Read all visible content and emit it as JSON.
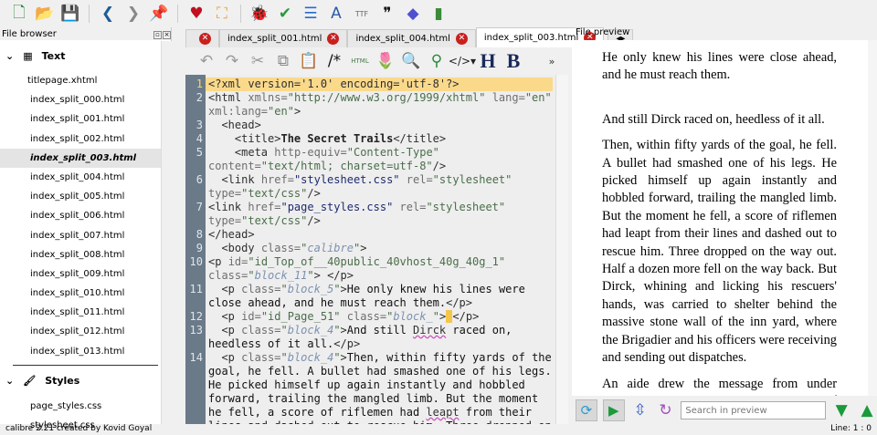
{
  "toolbar": {
    "icons": [
      "new-file-icon",
      "open-folder-icon",
      "save-icon",
      "back-icon",
      "forward-icon",
      "pin-icon",
      "heart-icon",
      "fullscreen-icon",
      "bug-icon",
      "spellcheck-icon",
      "reports-icon",
      "translate-icon",
      "font-icon",
      "quote-icon",
      "diamond-icon",
      "stats-icon"
    ],
    "glyphs": [
      "🗋",
      "📂",
      "💾",
      "❮",
      "❯",
      "📌",
      "♥",
      "⛶",
      "🐞",
      "✔",
      "☰",
      "A",
      "TTF",
      "❞",
      "◆",
      "▮"
    ]
  },
  "file_browser": {
    "title": "File browser",
    "groups": [
      {
        "label": "Text",
        "items": [
          "titlepage.xhtml",
          "index_split_000.html",
          "index_split_001.html",
          "index_split_002.html",
          "index_split_003.html",
          "index_split_004.html",
          "index_split_005.html",
          "index_split_006.html",
          "index_split_007.html",
          "index_split_008.html",
          "index_split_009.html",
          "index_split_010.html",
          "index_split_011.html",
          "index_split_012.html",
          "index_split_013.html"
        ],
        "selected": 4
      },
      {
        "label": "Styles",
        "items": [
          "page_styles.css",
          "stylesheet.css"
        ]
      }
    ]
  },
  "tabs": [
    {
      "label": "",
      "active": false
    },
    {
      "label": "index_split_001.html",
      "active": false
    },
    {
      "label": "index_split_004.html",
      "active": false
    },
    {
      "label": "index_split_003.html",
      "active": true
    }
  ],
  "editor_toolbar": {
    "glyphs": [
      "↶",
      "↷",
      "✂",
      "⧉",
      "📋",
      "/*",
      "HTML",
      "🌷",
      "🔍",
      "⚲",
      "</>▾",
      "H",
      "B",
      "»"
    ],
    "icons": [
      "undo-icon",
      "redo-icon",
      "cut-icon",
      "copy-icon",
      "paste-icon",
      "comment-icon",
      "html-icon",
      "tulip-icon",
      "image-search-icon",
      "link-icon",
      "tag-menu-icon",
      "heading-icon",
      "bold-icon",
      "more-icon"
    ]
  },
  "code": {
    "lines": [
      {
        "n": "1",
        "hl": true,
        "segs": [
          [
            "tag",
            "<?xml version='1.0' encoding='utf-8'?>"
          ]
        ]
      },
      {
        "n": "2",
        "segs": [
          [
            "tag",
            "<html "
          ],
          [
            "an",
            "xmlns="
          ],
          [
            "sv",
            "\"http://www.w3.org/1999/xhtml\" "
          ],
          [
            "an",
            "lang="
          ],
          [
            "sv",
            "\"en\" "
          ],
          [
            "an",
            "xml:lang="
          ],
          [
            "sv",
            "\"en\""
          ],
          [
            "tag",
            ">"
          ]
        ]
      },
      {
        "n": "3",
        "segs": [
          [
            "tag",
            "  <head>"
          ]
        ]
      },
      {
        "n": "4",
        "segs": [
          [
            "tag",
            "    <title>"
          ],
          [
            "bold",
            "The Secret Trails"
          ],
          [
            "tag",
            "</title>"
          ]
        ]
      },
      {
        "n": "5",
        "segs": [
          [
            "tag",
            "    <meta "
          ],
          [
            "an",
            "http-equiv="
          ],
          [
            "sv",
            "\"Content-Type\" "
          ],
          [
            "an",
            "content="
          ],
          [
            "sv",
            "\"text/html; charset=utf-8\""
          ],
          [
            "tag",
            "/>"
          ]
        ]
      },
      {
        "n": "6",
        "segs": [
          [
            "tag",
            "  <link "
          ],
          [
            "an",
            "href="
          ],
          [
            "sb",
            "\"stylesheet.css\" "
          ],
          [
            "an",
            "rel="
          ],
          [
            "sv",
            "\"stylesheet\" "
          ],
          [
            "an",
            "type="
          ],
          [
            "sv",
            "\"text/css\""
          ],
          [
            "tag",
            "/>"
          ]
        ]
      },
      {
        "n": "7",
        "segs": [
          [
            "tag",
            "<link "
          ],
          [
            "an",
            "href="
          ],
          [
            "sb",
            "\"page_styles.css\" "
          ],
          [
            "an",
            "rel="
          ],
          [
            "sv",
            "\"stylesheet\" "
          ],
          [
            "an",
            "type="
          ],
          [
            "sv",
            "\"text/css\""
          ],
          [
            "tag",
            "/>"
          ]
        ]
      },
      {
        "n": "8",
        "segs": [
          [
            "tag",
            "</head>"
          ]
        ]
      },
      {
        "n": "9",
        "segs": [
          [
            "tag",
            "  <body "
          ],
          [
            "an",
            "class="
          ],
          [
            "sv",
            "\""
          ],
          [
            "ci",
            "calibre"
          ],
          [
            "sv",
            "\""
          ],
          [
            "tag",
            ">"
          ]
        ]
      },
      {
        "n": "10",
        "segs": [
          [
            "tag",
            "<p "
          ],
          [
            "an",
            "id="
          ],
          [
            "sv",
            "\"id_Top_of__40public_40vhost_40g_40g_1\" "
          ],
          [
            "an",
            "class="
          ],
          [
            "sv",
            "\""
          ],
          [
            "ci",
            "block_11"
          ],
          [
            "sv",
            "\""
          ],
          [
            "tag",
            "> </p>"
          ]
        ]
      },
      {
        "n": "11",
        "segs": [
          [
            "tag",
            "  <p "
          ],
          [
            "an",
            "class="
          ],
          [
            "sv",
            "\""
          ],
          [
            "ci",
            "block_5"
          ],
          [
            "sv",
            "\""
          ],
          [
            "tag",
            ">"
          ],
          [
            "tx",
            "He only knew his lines were close ahead, and he must reach them."
          ],
          [
            "tag",
            "</p>"
          ]
        ]
      },
      {
        "n": "12",
        "segs": [
          [
            "tag",
            "  <p "
          ],
          [
            "an",
            "id="
          ],
          [
            "sv",
            "\"id_Page_51\" "
          ],
          [
            "an",
            "class="
          ],
          [
            "sv",
            "\""
          ],
          [
            "ci",
            "block_"
          ],
          [
            "sv",
            "\""
          ],
          [
            "tag",
            ">"
          ],
          [
            "cur",
            " "
          ],
          [
            "tag",
            "</p>"
          ]
        ]
      },
      {
        "n": "13",
        "segs": [
          [
            "tag",
            "  <p "
          ],
          [
            "an",
            "class="
          ],
          [
            "sv",
            "\""
          ],
          [
            "ci",
            "block_4"
          ],
          [
            "sv",
            "\""
          ],
          [
            "tag",
            ">"
          ],
          [
            "tx",
            "And still "
          ],
          [
            "sp",
            "Dirck"
          ],
          [
            "tx",
            " raced on, heedless of it all."
          ],
          [
            "tag",
            "</p>"
          ]
        ]
      },
      {
        "n": "14",
        "segs": [
          [
            "tag",
            "  <p "
          ],
          [
            "an",
            "class="
          ],
          [
            "sv",
            "\""
          ],
          [
            "ci",
            "block_4"
          ],
          [
            "sv",
            "\""
          ],
          [
            "tag",
            ">"
          ],
          [
            "tx",
            "Then, within fifty yards of the goal, he fell. A bullet had smashed one of his legs. He picked himself up again instantly and hobbled forward, trailing the mangled limb. But the moment he fell, a score of riflemen had "
          ],
          [
            "sp",
            "leapt"
          ],
          [
            "tx",
            " from their lines and dashed out to rescue him. Three dropped on the way"
          ]
        ]
      }
    ]
  },
  "preview": {
    "title": "File preview",
    "paragraphs": [
      "He only knew his lines were close ahead, and he must reach them.",
      "And still Dirck raced on, heedless of it all.",
      "Then, within fifty yards of the goal, he fell. A bullet had smashed one of his legs. He picked himself up again instantly and hobbled forward, trailing the mangled limb. But the moment he fell, a score of riflemen had leapt from their lines and dashed out to rescue him. Three dropped on the way out. Half a dozen more fell on the way back. But Dirck, whining and licking his rescuers' hands, was carried to shelter behind the massive stone wall of the inn yard, where the Brigadier and his officers were receiving and sending out dispatches.",
      "An aide drew the message from under Dirck's collar and handed it, with a word of explanation, to the General. The latter read it, glanced at the tiny sender..."
    ],
    "search_placeholder": "Search in preview"
  },
  "status": {
    "left": "calibre 2.21 created by Kovid Goyal",
    "right": "Line: 1 : 0"
  }
}
